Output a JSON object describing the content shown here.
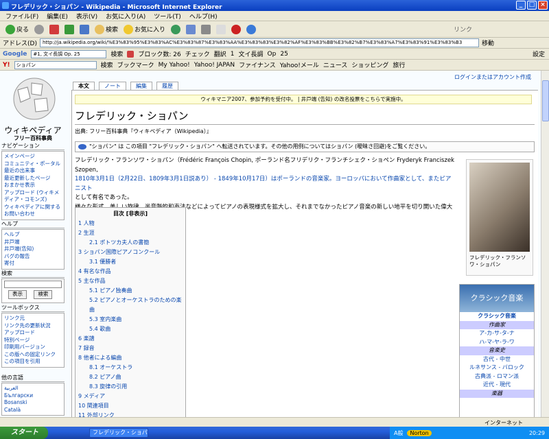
{
  "window": {
    "title": "フレデリック・ショパン - Wikipedia - Microsoft Internet Explorer",
    "controls": [
      "_",
      "□",
      "×"
    ]
  },
  "menu": [
    "ファイル(F)",
    "編集(E)",
    "表示(V)",
    "お気に入り(A)",
    "ツール(T)",
    "ヘルプ(H)"
  ],
  "toolbar": {
    "back": "戻る",
    "search": "検索",
    "favorites": "お気に入り",
    "links": "リンク"
  },
  "address": {
    "label": "アドレス(D)",
    "url": "http://ja.wikipedia.org/wiki/%E3%83%95%E3%83%AC%E3%83%87%E3%83%AA%E3%83%83%E3%82%AF%E3%83%BB%E3%82%B7%E3%83%A7%E3%83%91%E3%83%B3",
    "go": "移動"
  },
  "google_bar": {
    "brand": "Google",
    "query": "#1, 文イ長調 Op. 25",
    "search": "検索",
    "blocked": "ブロック数: 26",
    "check": "チェック",
    "translate": "翻訳",
    "highlight": "1",
    "term1": "文イ長調",
    "term2": "Op",
    "term3": "25",
    "settings": "設定"
  },
  "yahoo_bar": {
    "brand": "Y!",
    "query": "ショパン",
    "search": "検索",
    "bookmarks": "ブックマーク",
    "my_yahoo": "My Yahoo!",
    "yahoo_japan": "Yahoo! JAPAN",
    "finance": "ファイナンス",
    "mail": "Yahoo!メール",
    "news": "ニュース",
    "shopping": "ショッピング",
    "travel": "旅行"
  },
  "sidebar": {
    "site_name": "ウィキペディア",
    "site_sub": "フリー百科事典",
    "navigation": {
      "title": "ナビゲーション",
      "items": [
        "メインページ",
        "コミュニティ・ポータル",
        "最近の出来事",
        "最近更新したページ",
        "おまかせ表示",
        "アップロード (ウィキメディア・コモンズ)",
        "ウィキペディアに関するお問い合わせ"
      ]
    },
    "help": {
      "title": "ヘルプ",
      "items": [
        "ヘルプ",
        "井戸端",
        "井戸端(告知)",
        "バグの報告",
        "寄付"
      ]
    },
    "search": {
      "title": "検索",
      "go": "表示",
      "search": "検索"
    },
    "toolbox": {
      "title": "ツールボックス",
      "items": [
        "リンク元",
        "リンク先の更新状況",
        "アップロード",
        "特別ページ",
        "印刷用バージョン",
        "この版への固定リンク",
        "この項目を引用"
      ]
    },
    "languages": {
      "title": "他の言語",
      "items": [
        "العربية",
        "Български",
        "Bosanski",
        "Català"
      ]
    }
  },
  "tabs": [
    "本文",
    "ノート",
    "編集",
    "履歴"
  ],
  "login": "ログインまたはアカウント作成",
  "notice": "ウィキマニア2007、参加予約を受付中。 | 井戸端 (告知) の改名投票をこちらで実施中。",
  "article": {
    "title": "フレデリック・ショパン",
    "from": "出典: フリー百科事典『ウィキペディア（Wikipedia）』",
    "redirect": "\"ショパン\" は この項目 \"フレデリック・ショパン\" へ転送されています。その他の用例についてはショパン (曖昧さ回避)をご覧ください。",
    "p1a": "フレデリック・フランソワ・ショパン（Frédéric François Chopin, ポーランド名フリデリク・フランチシェク・ショペン Fryderyk Franciszek Szopen,",
    "p1b": "1810年3月1日（2月22日、1809年3月1日説あり） - 1849年10月17日）はポーランドの音楽家。ヨーロッパにおいて作曲家として、またピアニスト",
    "p1c": "として有名であった。",
    "p2": "様々な形式、美しい旋律、半音階的和声法などによってピアノの表現様式を拡大し、それまでなかったピアノ音楽の新しい地平を切り開いた偉大な作曲家の一人である。"
  },
  "toc": {
    "title": "目次 [非表示]",
    "items": [
      {
        "label": "1 人物",
        "level": 1
      },
      {
        "label": "2 生涯",
        "level": 1
      },
      {
        "label": "2.1 ポトツカ夫人の書簡",
        "level": 2
      },
      {
        "label": "3 ショパン国際ピアノコンクール",
        "level": 1
      },
      {
        "label": "3.1 優勝者",
        "level": 2
      },
      {
        "label": "4 有名な作品",
        "level": 1
      },
      {
        "label": "5 主な作品",
        "level": 1
      },
      {
        "label": "5.1 ピアノ独奏曲",
        "level": 2
      },
      {
        "label": "5.2 ピアノとオーケストラのための楽曲",
        "level": 2
      },
      {
        "label": "5.3 室内楽曲",
        "level": 2
      },
      {
        "label": "5.4 歌曲",
        "level": 2
      },
      {
        "label": "6 楽譜",
        "level": 1
      },
      {
        "label": "7 録音",
        "level": 1
      },
      {
        "label": "8 他者による編曲",
        "level": 1
      },
      {
        "label": "8.1 オーケストラ",
        "level": 2
      },
      {
        "label": "8.2 ピアノ曲",
        "level": 2
      },
      {
        "label": "8.3 旋律の引用",
        "level": 2
      },
      {
        "label": "9 メディア",
        "level": 1
      },
      {
        "label": "10 関連項目",
        "level": 1
      },
      {
        "label": "11 外部リンク",
        "level": 1
      }
    ]
  },
  "portrait_caption": "フレデリック・フランソワ・ショパン",
  "navbox": {
    "header": "クラシック音楽",
    "title": "クラシック音楽",
    "rows": [
      {
        "t": "作曲家",
        "kind": "sec"
      },
      {
        "t": "ア-カ-サ-タ-ナ",
        "kind": "lnk"
      },
      {
        "t": "ハ-マ-ヤ-ラ-ワ",
        "kind": "lnk"
      },
      {
        "t": "音楽史",
        "kind": "sec"
      },
      {
        "t": "古代 - 中世",
        "kind": "lnk"
      },
      {
        "t": "ルネサンス - バロック",
        "kind": "lnk"
      },
      {
        "t": "古典派 - ロマン派",
        "kind": "lnk"
      },
      {
        "t": "近代 - 現代",
        "kind": "lnk"
      },
      {
        "t": "楽器",
        "kind": "sec"
      }
    ]
  },
  "status": {
    "zone": "インターネット"
  },
  "taskbar": {
    "start": "スタート",
    "task": "フレデリック・ショパン - ...",
    "ime": "A般",
    "norton": "Norton",
    "clock": "20:29"
  },
  "colors": {
    "link": "#0645ad",
    "title_bar": "#0a3fc0",
    "notice_bg": "#ffffd8"
  }
}
